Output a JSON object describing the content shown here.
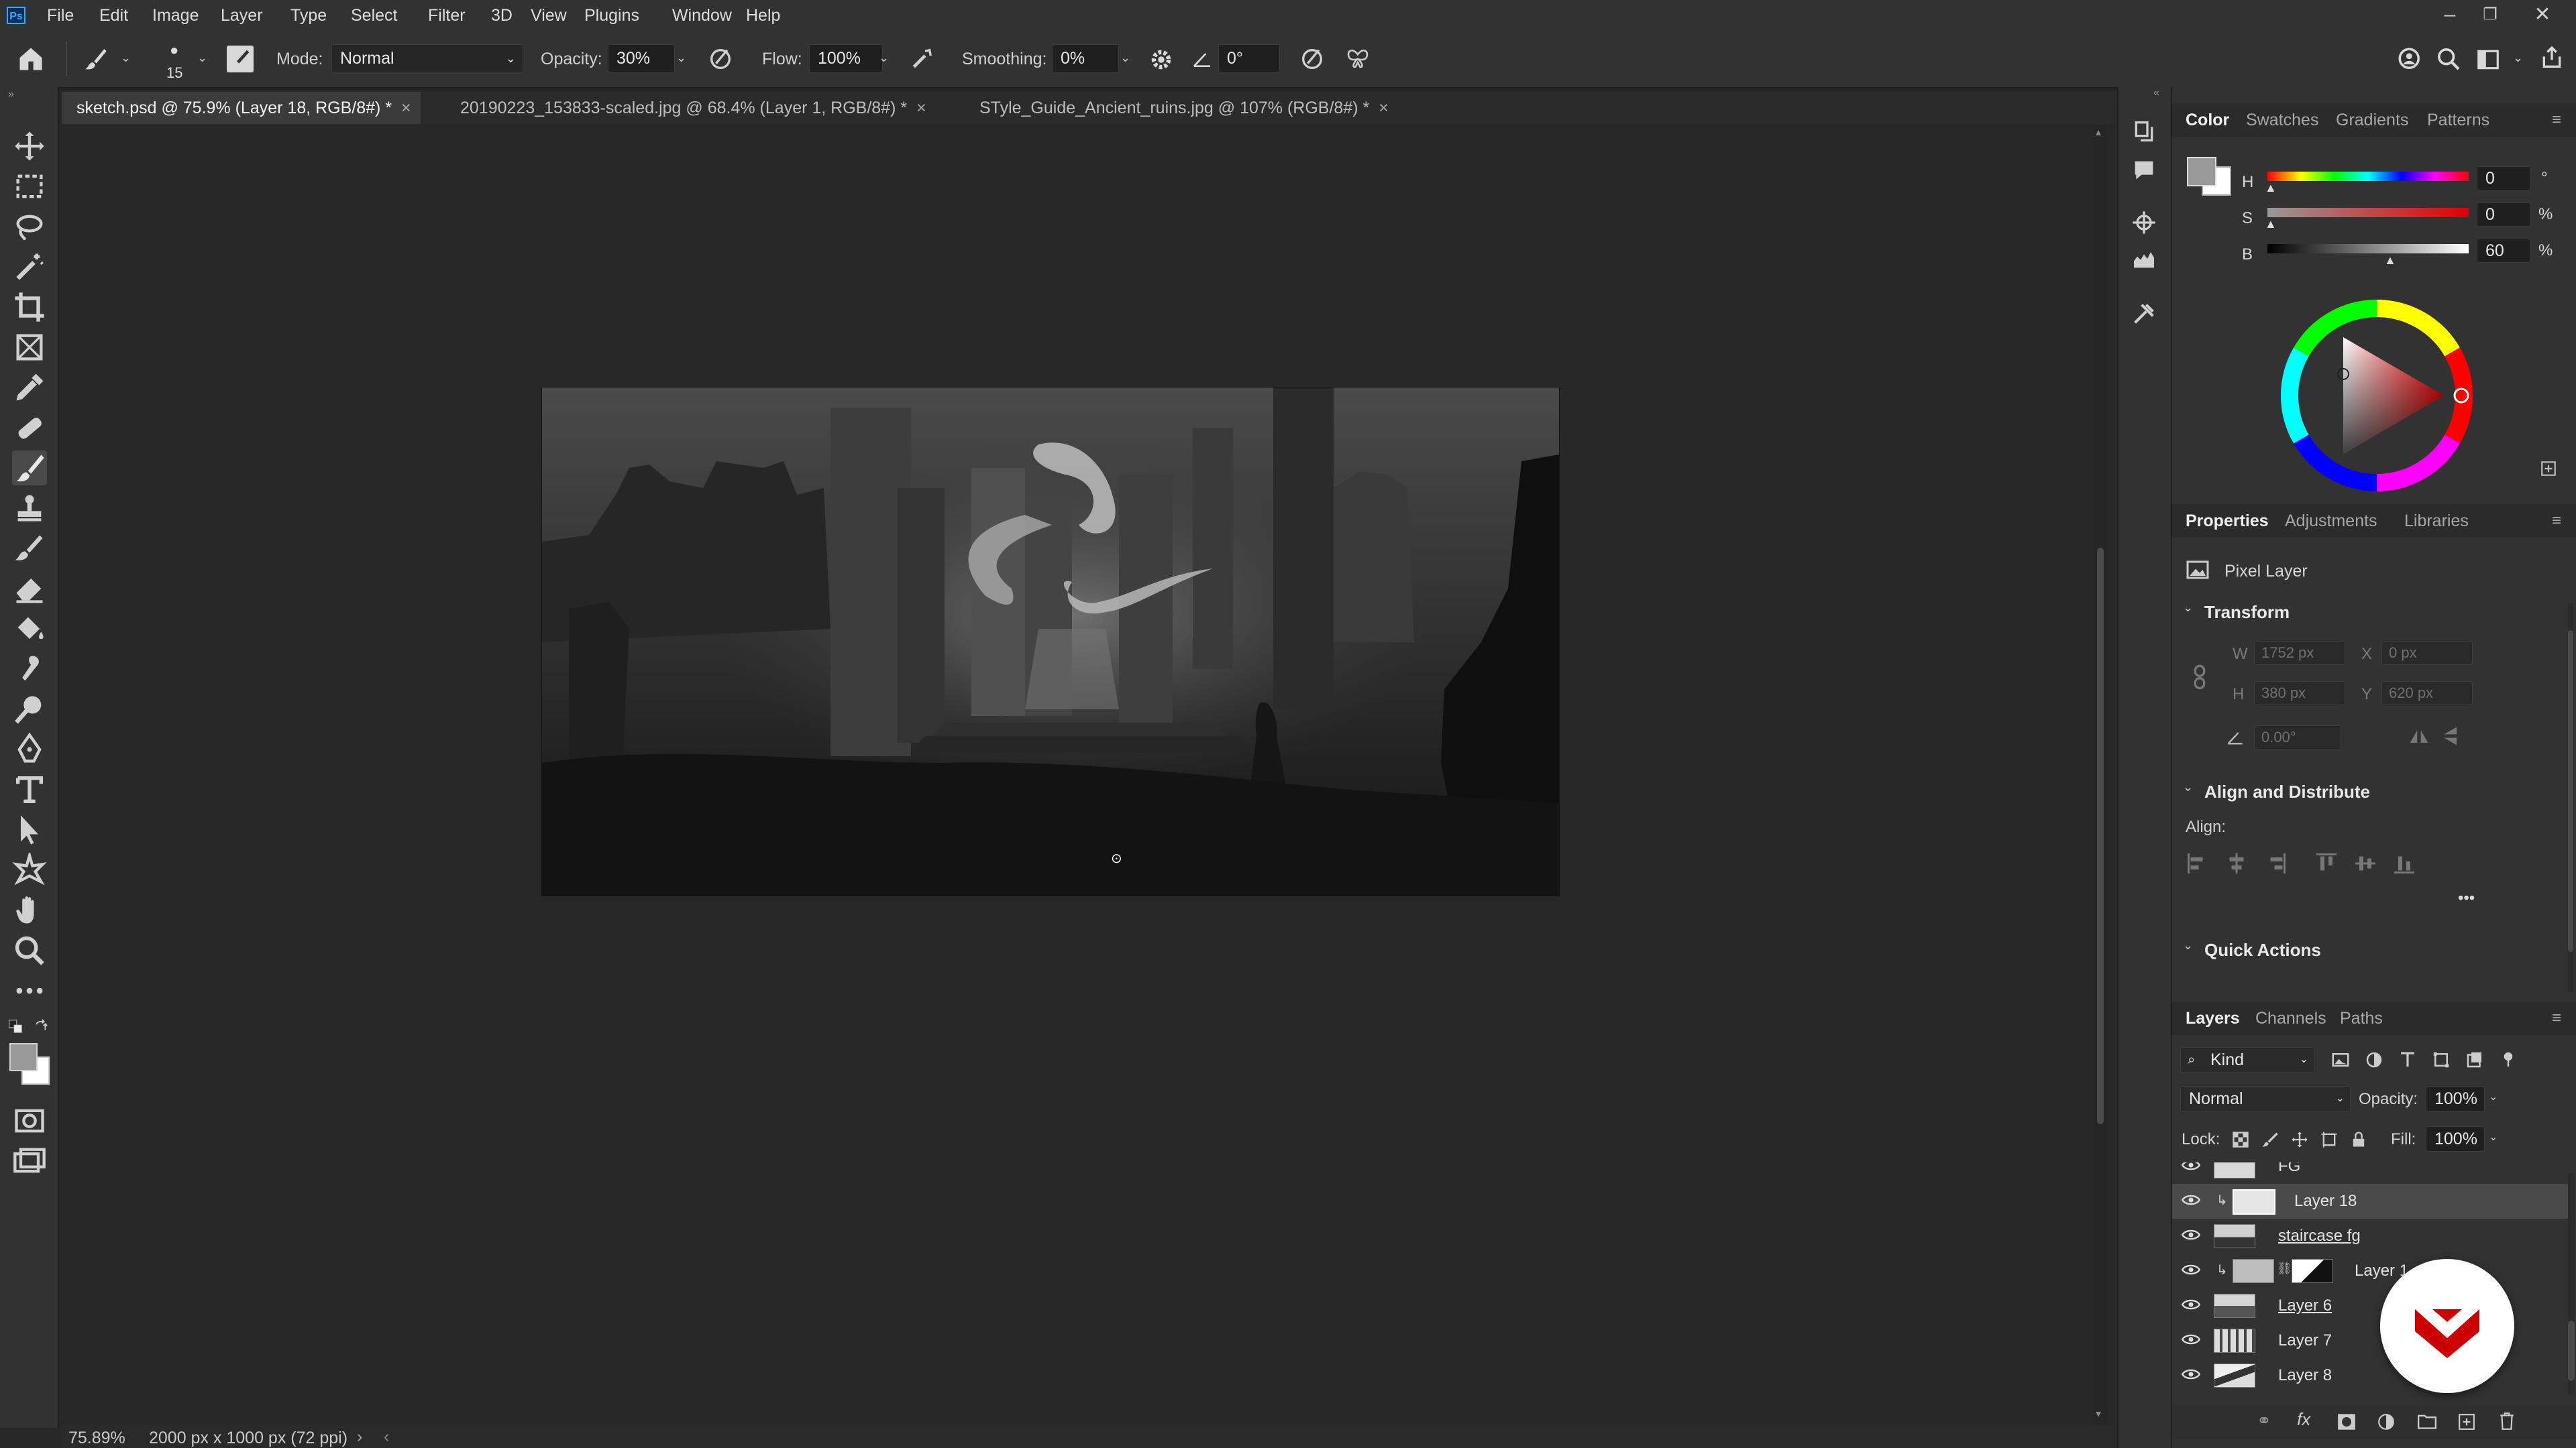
{
  "menu": {
    "items": [
      "File",
      "Edit",
      "Image",
      "Layer",
      "Type",
      "Select",
      "Filter",
      "3D",
      "View",
      "Plugins",
      "Window",
      "Help"
    ],
    "app_logo": "Ps"
  },
  "options_bar": {
    "brush_size": "15",
    "mode_label": "Mode:",
    "mode_value": "Normal",
    "opacity_label": "Opacity:",
    "opacity_value": "30%",
    "flow_label": "Flow:",
    "flow_value": "100%",
    "smoothing_label": "Smoothing:",
    "smoothing_value": "0%",
    "angle_value": "0°"
  },
  "tabs": [
    {
      "label": "sketch.psd @ 75.9% (Layer 18, RGB/8#) *",
      "active": true
    },
    {
      "label": "20190223_153833-scaled.jpg @ 68.4% (Layer 1, RGB/8#) *",
      "active": false
    },
    {
      "label": "STyle_Guide_Ancient_ruins.jpg @ 107% (RGB/8#) *",
      "active": false
    }
  ],
  "status": {
    "zoom": "75.89%",
    "doc_info": "2000 px x 1000 px (72 ppi)"
  },
  "color_panel": {
    "tabs": [
      "Color",
      "Swatches",
      "Gradients",
      "Patterns"
    ],
    "h_label": "H",
    "h_value": "0",
    "h_unit": "°",
    "s_label": "S",
    "s_value": "0",
    "s_unit": "%",
    "b_label": "B",
    "b_value": "60",
    "b_unit": "%",
    "foreground": "#999999",
    "background": "#ffffff"
  },
  "properties_panel": {
    "tabs": [
      "Properties",
      "Adjustments",
      "Libraries"
    ],
    "type_label": "Pixel Layer",
    "transform_title": "Transform",
    "w_label": "W",
    "w_value": "1752 px",
    "x_label": "X",
    "x_value": "0 px",
    "h_label": "H",
    "h_value": "380 px",
    "y_label": "Y",
    "y_value": "620 px",
    "angle_value": "0.00°",
    "align_title": "Align and Distribute",
    "align_label": "Align:",
    "more": "•••",
    "quick_actions_title": "Quick Actions"
  },
  "layers_panel": {
    "tabs": [
      "Layers",
      "Channels",
      "Paths"
    ],
    "filter_kind": "Kind",
    "blend_mode": "Normal",
    "opacity_label": "Opacity:",
    "opacity_value": "100%",
    "lock_label": "Lock:",
    "fill_label": "Fill:",
    "fill_value": "100%",
    "layers": [
      {
        "name": "FG"
      },
      {
        "name": "Layer 18",
        "selected": true
      },
      {
        "name": "staircase fg"
      },
      {
        "name": "Layer 1"
      },
      {
        "name": "Layer 6"
      },
      {
        "name": "Layer 7"
      },
      {
        "name": "Layer 8"
      }
    ]
  },
  "accent": "#31a8ff"
}
